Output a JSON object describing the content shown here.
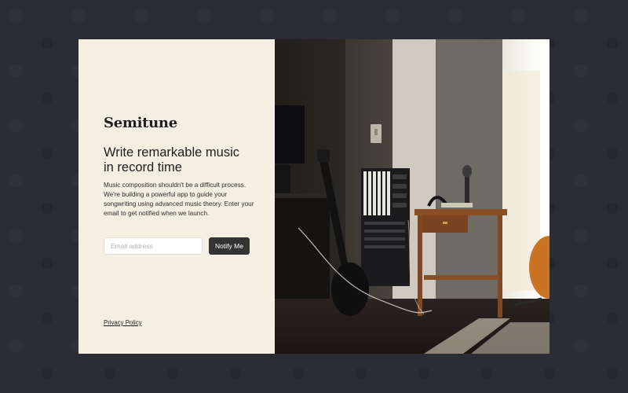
{
  "brand": {
    "name": "Semitune"
  },
  "hero": {
    "headline_line1": "Write remarkable music",
    "headline_line2": "in record time",
    "description": "Music composition shouldn't be a difficult process. We're building a powerful app to guide your songwriting using advanced music theory. Enter your email to get notified when we launch."
  },
  "signup": {
    "email_placeholder": "Email address",
    "email_value": "",
    "notify_label": "Notify Me"
  },
  "footer": {
    "privacy_label": "Privacy Policy"
  },
  "colors": {
    "page_background": "#2b2d33",
    "panel_background": "#f4efe3",
    "button_background": "#333333",
    "text": "#1e1e1e"
  },
  "image": {
    "subject": "music-studio-photo"
  }
}
